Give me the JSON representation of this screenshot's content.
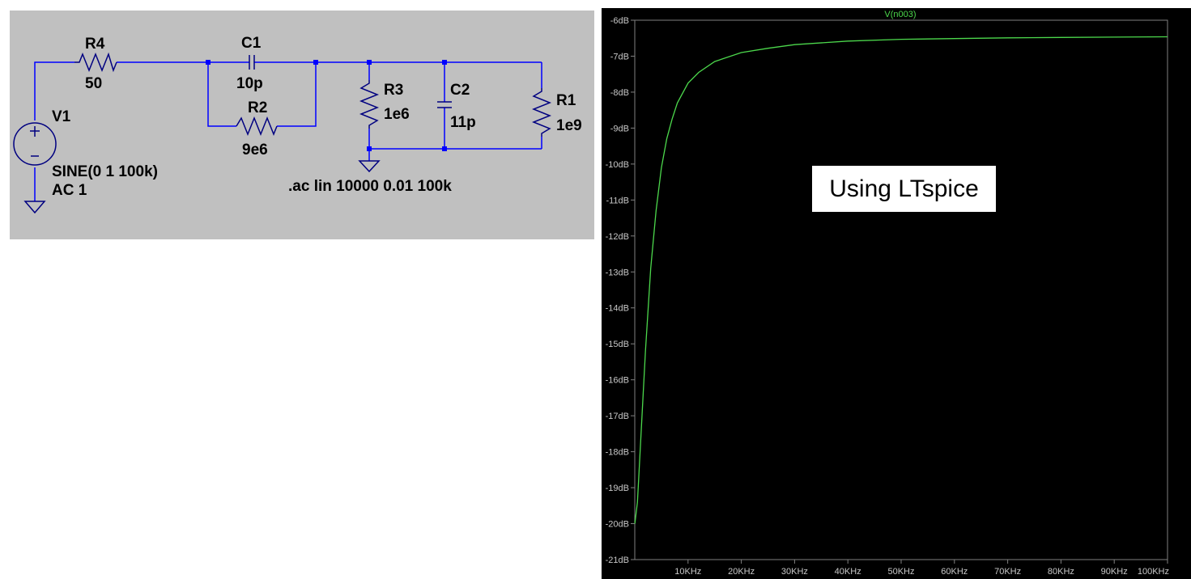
{
  "schematic": {
    "components": {
      "r4": {
        "name": "R4",
        "value": "50"
      },
      "c1": {
        "name": "C1",
        "value": "10p"
      },
      "r2": {
        "name": "R2",
        "value": "9e6"
      },
      "r3": {
        "name": "R3",
        "value": "1e6"
      },
      "c2": {
        "name": "C2",
        "value": "11p"
      },
      "r1": {
        "name": "R1",
        "value": "1e9"
      },
      "v1": {
        "name": "V1",
        "value": "SINE(0 1 100k)",
        "ac": "AC 1"
      }
    },
    "directive": ".ac lin 10000 0.01 100k",
    "colors": {
      "background": "#c0c0c0",
      "wire": "#0000ff",
      "junction": "#0000ff",
      "component": "#000080"
    }
  },
  "overlay": {
    "text": "Using LTspice"
  },
  "plot": {
    "colors": {
      "background": "#000000",
      "trace": "#4cd84c",
      "frame": "#808080",
      "text": "#c8c8c8"
    }
  },
  "chart_data": {
    "type": "line",
    "title": "V(n003)",
    "x_unit": "KHz",
    "xlim": [
      0,
      100
    ],
    "ylim": [
      -21,
      -6
    ],
    "x_ticks": [
      "10KHz",
      "20KHz",
      "30KHz",
      "40KHz",
      "50KHz",
      "60KHz",
      "70KHz",
      "80KHz",
      "90KHz",
      "100KHz"
    ],
    "y_ticks": [
      "-6dB",
      "-7dB",
      "-8dB",
      "-9dB",
      "-10dB",
      "-11dB",
      "-12dB",
      "-13dB",
      "-14dB",
      "-15dB",
      "-16dB",
      "-17dB",
      "-18dB",
      "-19dB",
      "-20dB",
      "-21dB"
    ],
    "series": [
      {
        "name": "V(n003)",
        "x": [
          0.01,
          0.5,
          1,
          1.5,
          2,
          3,
          4,
          5,
          6,
          7,
          8,
          10,
          12,
          15,
          20,
          25,
          30,
          40,
          50,
          60,
          70,
          80,
          90,
          100
        ],
        "y": [
          -20.0,
          -19.4,
          -18.0,
          -16.6,
          -15.2,
          -12.9,
          -11.3,
          -10.1,
          -9.3,
          -8.75,
          -8.3,
          -7.75,
          -7.45,
          -7.15,
          -6.9,
          -6.78,
          -6.68,
          -6.58,
          -6.53,
          -6.51,
          -6.49,
          -6.48,
          -6.47,
          -6.46
        ]
      }
    ]
  }
}
